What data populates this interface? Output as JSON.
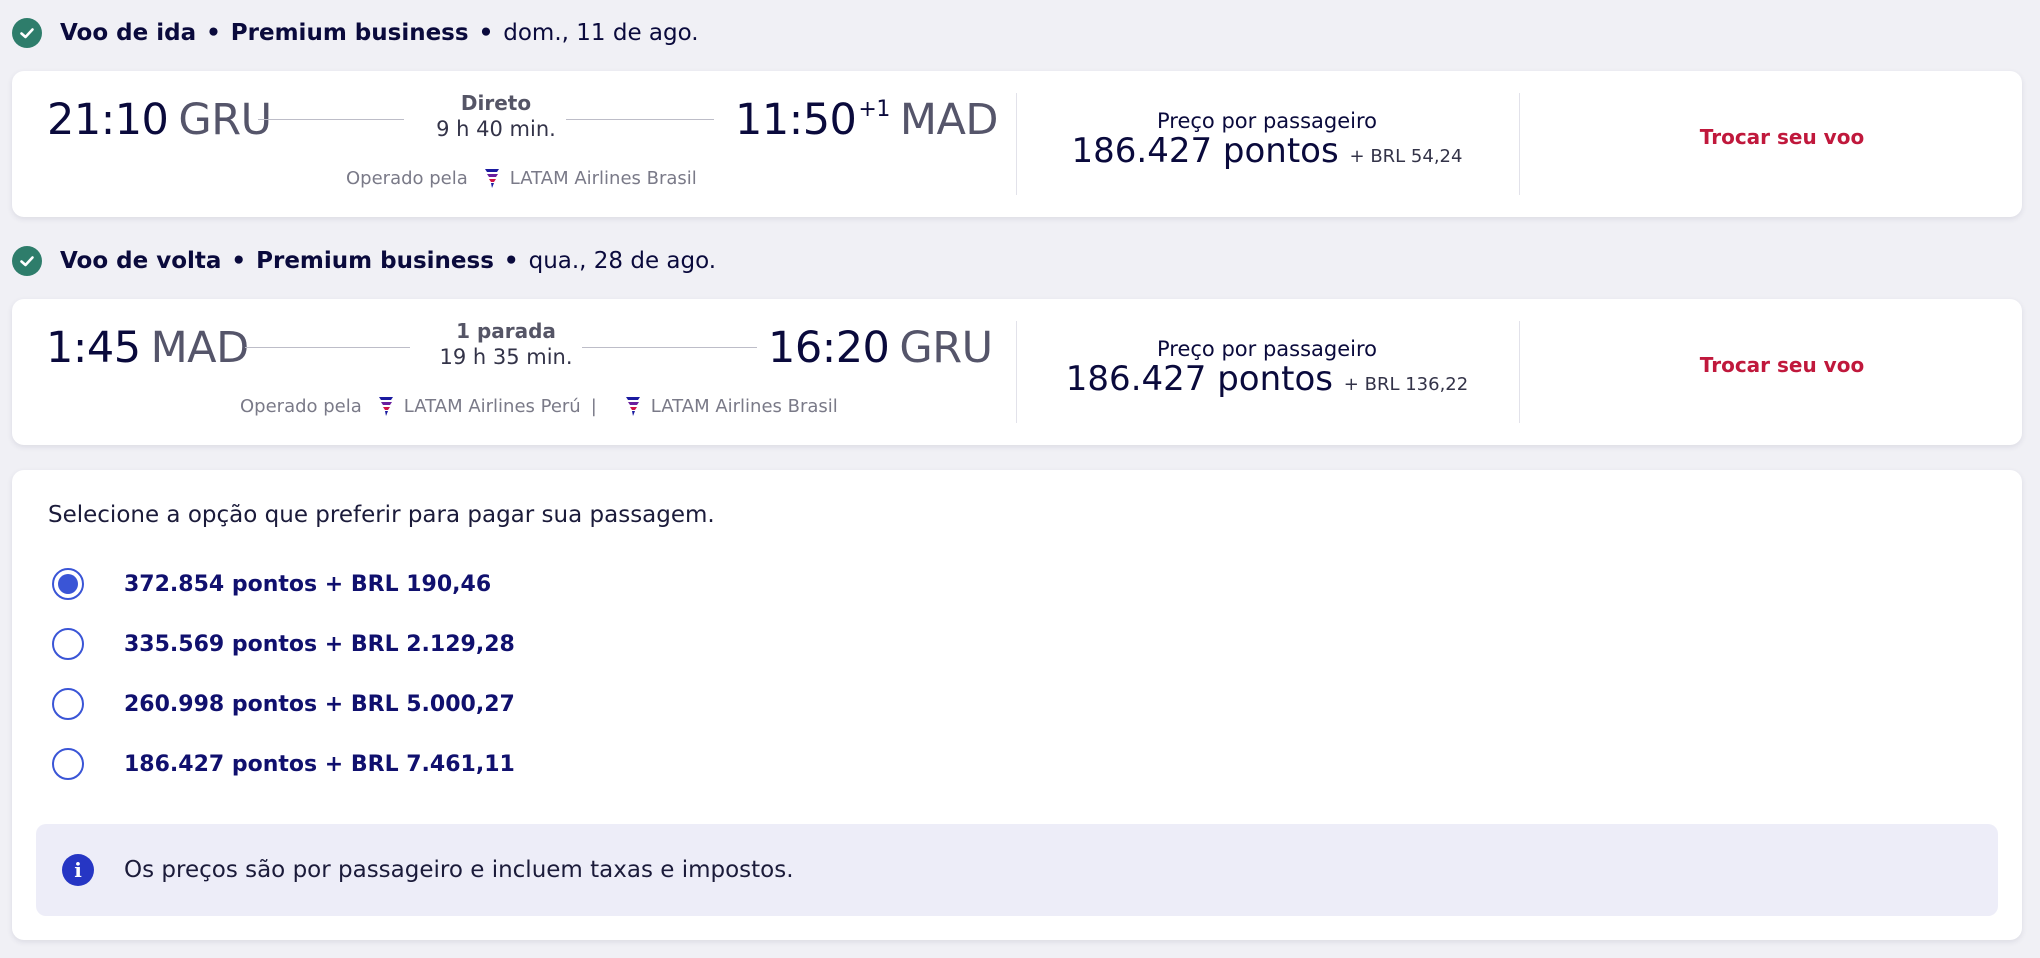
{
  "outbound": {
    "header": {
      "direction": "Voo de ida",
      "cabin": "Premium business",
      "bullet": "•",
      "date": "dom., 11 de ago."
    },
    "departure_time": "21:10",
    "departure_code": "GRU",
    "stops": "Direto",
    "duration": "9 h 40 min.",
    "arrival_time": "11:50",
    "arrival_day_offset": "+1",
    "arrival_code": "MAD",
    "operated_by_label": "Operado pela",
    "airlines": [
      "LATAM Airlines Brasil"
    ],
    "price_label": "Preço por passageiro",
    "price_points": "186.427 pontos",
    "price_extra": "+ BRL 54,24",
    "change_label": "Trocar seu voo"
  },
  "return": {
    "header": {
      "direction": "Voo de volta",
      "cabin": "Premium business",
      "bullet": "•",
      "date": "qua., 28 de ago."
    },
    "departure_time": "1:45",
    "departure_code": "MAD",
    "stops": "1 parada",
    "duration": "19 h 35 min.",
    "arrival_time": "16:20",
    "arrival_code": "GRU",
    "operated_by_label": "Operado pela",
    "airlines": [
      "LATAM Airlines Perú",
      "LATAM Airlines Brasil"
    ],
    "airline_separator": "|",
    "price_label": "Preço por passageiro",
    "price_points": "186.427 pontos",
    "price_extra": "+ BRL 136,22",
    "change_label": "Trocar seu voo"
  },
  "payment": {
    "title": "Selecione a opção que preferir para pagar sua passagem.",
    "options": [
      {
        "label": "372.854 pontos + BRL 190,46",
        "selected": true
      },
      {
        "label": "335.569 pontos + BRL 2.129,28",
        "selected": false
      },
      {
        "label": "260.998 pontos + BRL 5.000,27",
        "selected": false
      },
      {
        "label": "186.427 pontos + BRL 7.461,11",
        "selected": false
      }
    ],
    "info_icon_glyph": "i",
    "info_text": "Os preços são por passageiro e incluem taxas e impostos."
  },
  "colors": {
    "check": "#2e7d6b",
    "accent_red": "#c0183c",
    "radio_blue": "#3a55d6",
    "option_text": "#10106e",
    "info_bg": "#ededf8",
    "info_icon": "#2636c4"
  },
  "icons": {
    "section_check": "check-circle-icon",
    "airline_logo": "latam-logo-icon",
    "info": "info-icon"
  }
}
